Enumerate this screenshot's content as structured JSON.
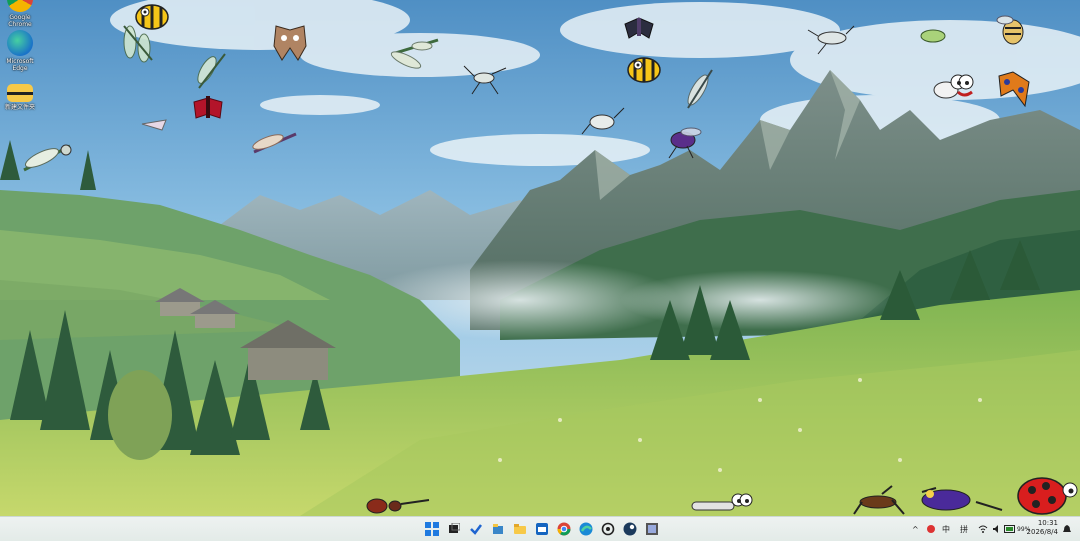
{
  "desktop": {
    "icons": [
      {
        "label": "Google Chrome"
      },
      {
        "label": "Microsoft Edge"
      },
      {
        "label": "新建文件夹"
      }
    ]
  },
  "taskbar": {
    "apps": [
      "start-icon",
      "task-view-icon",
      "todo-icon",
      "explorer-icon",
      "folder-icon",
      "outlook-icon",
      "chrome-icon",
      "edge-icon",
      "openai-icon",
      "steam-icon",
      "app-icon"
    ],
    "tray": {
      "chevron": "^",
      "input_method": "中",
      "layout": "拼",
      "battery": "99%",
      "time": "10:31",
      "date": "2026/8/4"
    }
  },
  "colors": {
    "sky": "#7cb6dc",
    "meadow": "#8cbc52",
    "taskbar": "#e9efed"
  }
}
